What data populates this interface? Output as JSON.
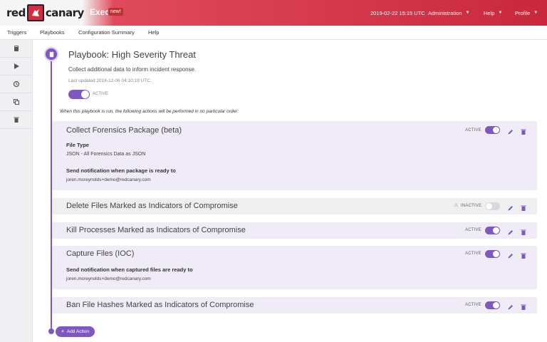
{
  "header": {
    "logo_left": "red",
    "logo_right": "canary",
    "product": "Exec",
    "badge": "new!",
    "datetime": "2019-02-22 15:15 UTC",
    "menus": [
      "Administration",
      "Help",
      "Profile"
    ]
  },
  "subnav": [
    "Triggers",
    "Playbooks",
    "Configuration Summary",
    "Help"
  ],
  "rail_icons": [
    "book-icon",
    "play-icon",
    "history-icon",
    "copy-icon",
    "trash-icon"
  ],
  "playbook": {
    "title": "Playbook: High Severity Threat",
    "description": "Collect additional data to inform incident response.",
    "updated": "Last updated 2018-12-06 04:10:19 UTC.",
    "status": "ACTIVE",
    "instructions": "When this playbook is run, the following actions will be performed in no particular order:"
  },
  "actions": [
    {
      "title": "Collect Forensics Package (beta)",
      "status": "ACTIVE",
      "enabled": true,
      "fields": [
        {
          "label": "File Type",
          "value": "JSON - All Forensics Data as JSON"
        },
        {
          "label": "Send notification when package is ready to",
          "value": "joren.mcreynolds+demo@redcanary.com"
        }
      ]
    },
    {
      "title": "Delete Files Marked as Indicators of Compromise",
      "status": "INACTIVE",
      "enabled": false,
      "fields": []
    },
    {
      "title": "Kill Processes Marked as Indicators of Compromise",
      "status": "ACTIVE",
      "enabled": true,
      "fields": []
    },
    {
      "title": "Capture Files (IOC)",
      "status": "ACTIVE",
      "enabled": true,
      "fields": [
        {
          "label": "Send notification when captured files are ready to",
          "value": "joren.mcreynolds+demo@redcanary.com"
        }
      ]
    },
    {
      "title": "Ban File Hashes Marked as Indicators of Compromise",
      "status": "ACTIVE",
      "enabled": true,
      "fields": []
    }
  ],
  "add_action": "Add Action",
  "colors": {
    "brand_red": "#d42d42",
    "accent_purple": "#7e57c2",
    "warning": "#e8891d"
  }
}
